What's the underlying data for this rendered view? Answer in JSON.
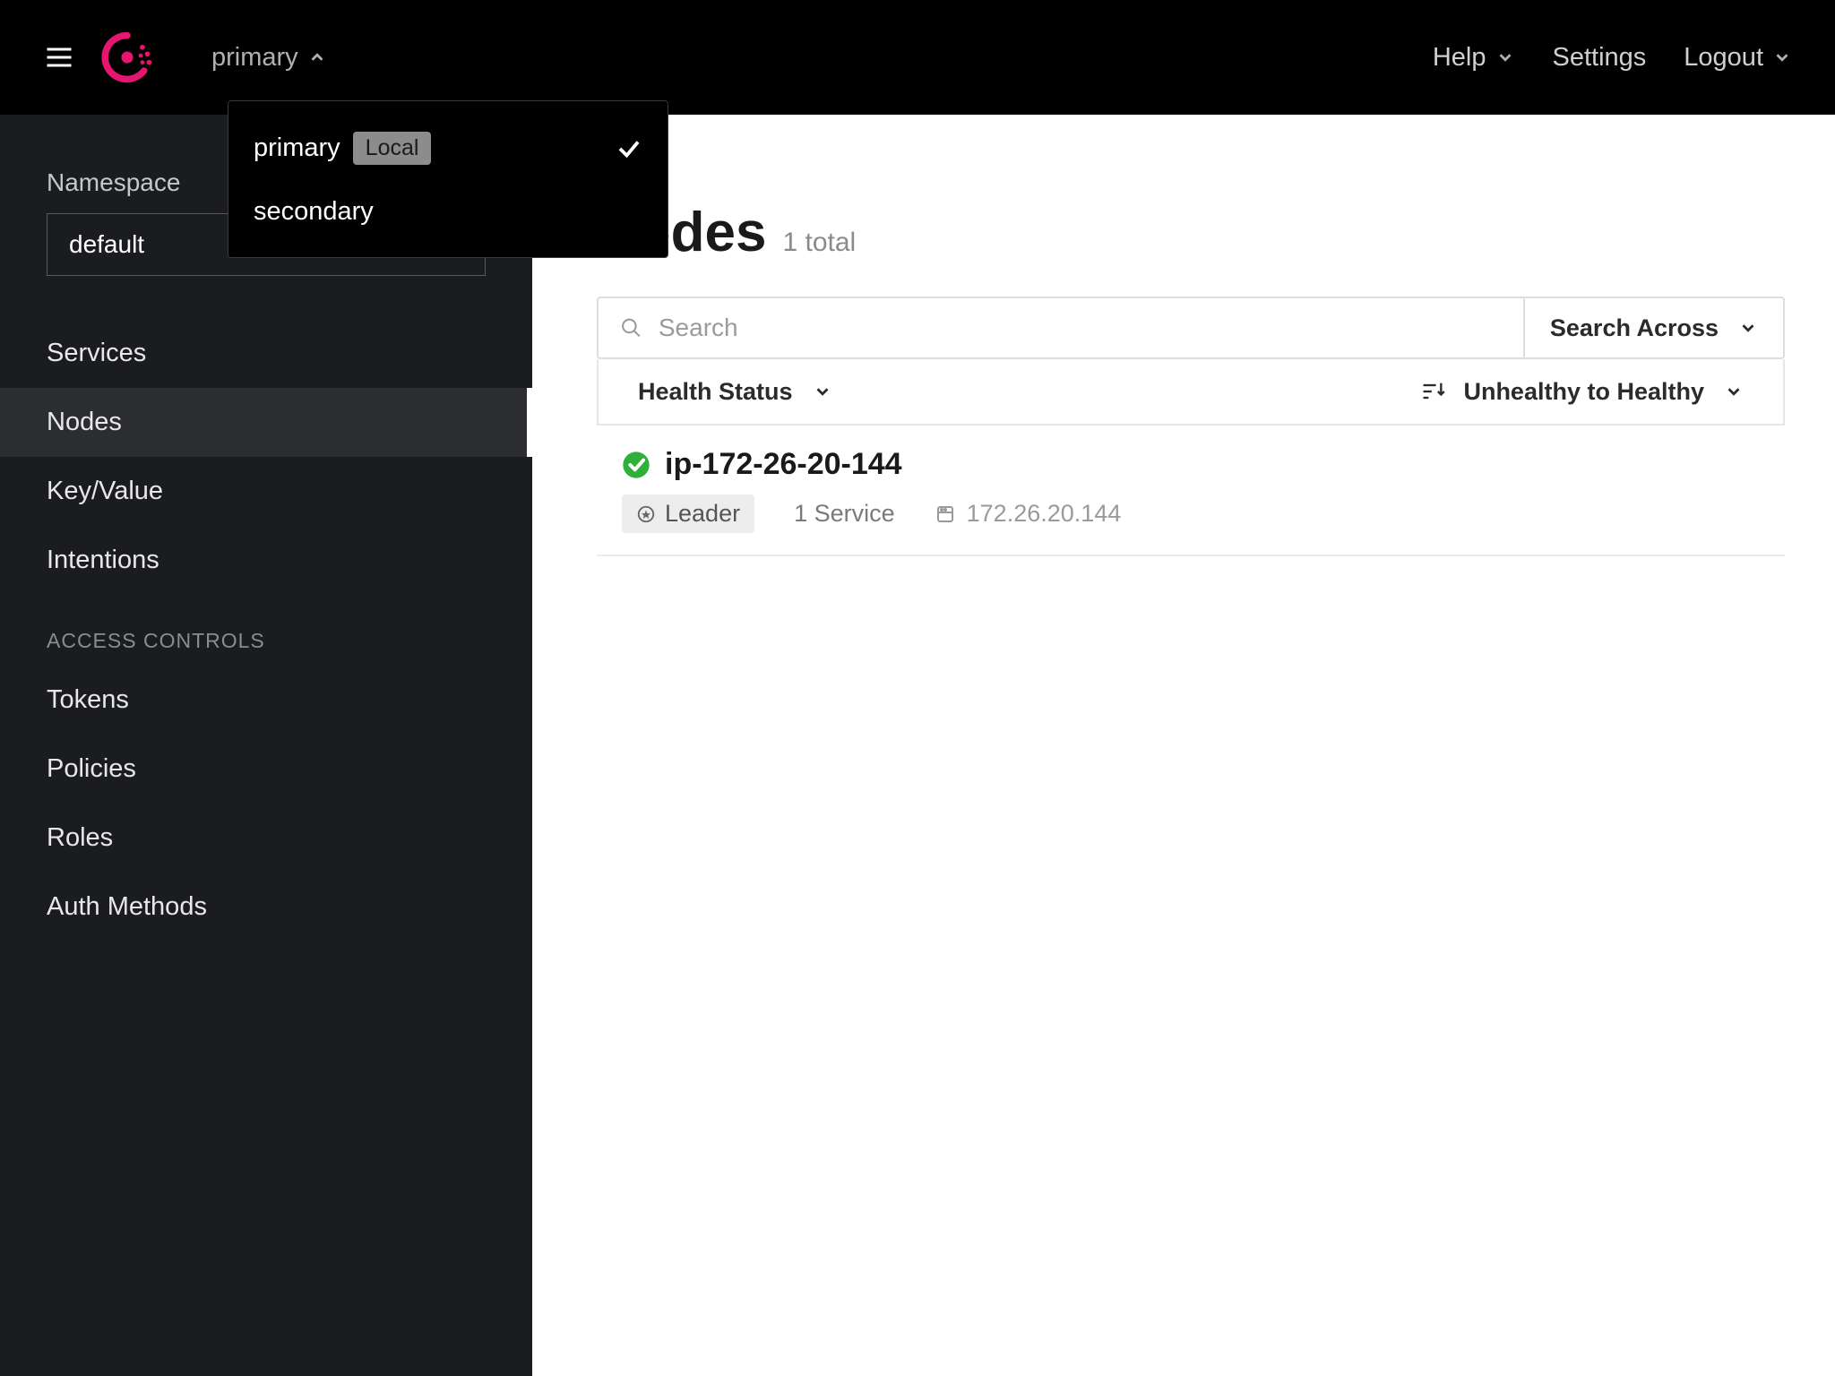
{
  "header": {
    "datacenter_selected": "primary",
    "nav": {
      "help": "Help",
      "settings": "Settings",
      "logout": "Logout"
    }
  },
  "dc_dropdown": {
    "options": [
      {
        "label": "primary",
        "badge": "Local",
        "selected": true
      },
      {
        "label": "secondary",
        "badge": null,
        "selected": false
      }
    ]
  },
  "sidebar": {
    "namespace_label": "Namespace",
    "namespace_value": "default",
    "items": [
      {
        "label": "Services",
        "active": false
      },
      {
        "label": "Nodes",
        "active": true
      },
      {
        "label": "Key/Value",
        "active": false
      },
      {
        "label": "Intentions",
        "active": false
      }
    ],
    "section_label": "ACCESS CONTROLS",
    "access_items": [
      {
        "label": "Tokens"
      },
      {
        "label": "Policies"
      },
      {
        "label": "Roles"
      },
      {
        "label": "Auth Methods"
      }
    ]
  },
  "main": {
    "title": "Nodes",
    "count_label": "1 total",
    "search_placeholder": "Search",
    "search_across_label": "Search Across",
    "filter_label": "Health Status",
    "sort_label": "Unhealthy to Healthy"
  },
  "nodes": [
    {
      "name": "ip-172-26-20-144",
      "leader_label": "Leader",
      "services_label": "1 Service",
      "ip": "172.26.20.144"
    }
  ]
}
